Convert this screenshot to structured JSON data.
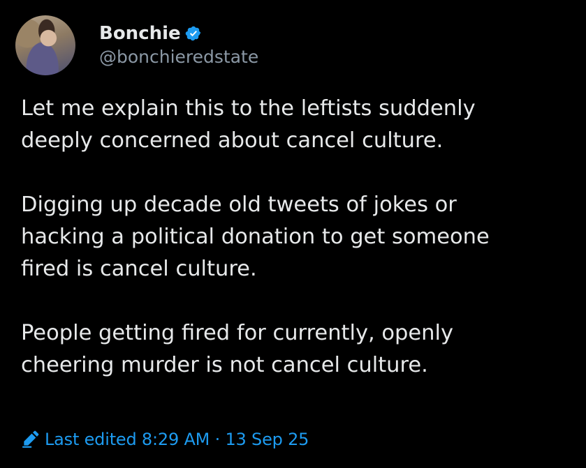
{
  "author": {
    "display_name": "Bonchie",
    "handle": "@bonchieredstate",
    "verified": true,
    "avatar_icon": "avatar-photo"
  },
  "tweet": {
    "paragraphs": [
      "Let me explain this to the leftists suddenly\ndeeply concerned about cancel culture.",
      "Digging up decade old tweets of jokes or\nhacking a political donation to get someone\nfired is cancel culture.",
      "People getting fired for currently, openly\ncheering murder is not cancel culture."
    ],
    "edited_label": "Last edited 8:29 AM · 13 Sep 25",
    "edited_icon": "pencil-icon"
  },
  "colors": {
    "background": "#000000",
    "text": "#e7e9ea",
    "muted": "#8b98a5",
    "accent": "#1d9bf0"
  }
}
